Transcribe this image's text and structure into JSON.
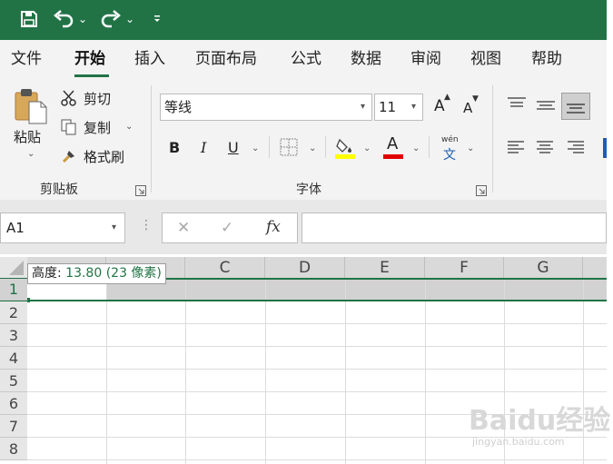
{
  "quick_access": {
    "save_icon": "save-icon",
    "undo_icon": "undo-icon",
    "redo_icon": "redo-icon",
    "customize_icon": "customize-icon",
    "dropdown": "⌄"
  },
  "menu": {
    "tabs": [
      "文件",
      "开始",
      "插入",
      "页面布局",
      "公式",
      "数据",
      "审阅",
      "视图",
      "帮助"
    ],
    "active": "开始"
  },
  "ribbon": {
    "clipboard": {
      "paste": "粘贴",
      "cut": "剪切",
      "copy": "复制",
      "format_painter": "格式刷",
      "group_label": "剪贴板"
    },
    "font": {
      "font_name": "等线",
      "font_size": "11",
      "grow": "A",
      "shrink": "A",
      "bold": "B",
      "italic": "I",
      "underline": "U",
      "font_color": "A",
      "phonetic_top": "wén",
      "phonetic_bottom": "文",
      "group_label": "字体"
    }
  },
  "formula_bar": {
    "name_box": "A1",
    "cancel": "✕",
    "enter": "✓",
    "fx": "fx",
    "formula": ""
  },
  "grid": {
    "columns": [
      "C",
      "D",
      "E",
      "F",
      "G"
    ],
    "rows": [
      "1",
      "2",
      "3",
      "4",
      "5",
      "6",
      "7",
      "8"
    ],
    "tooltip_label": "高度: ",
    "tooltip_value": "13.80 (23 像素)"
  },
  "watermark": {
    "text": "Baidu经验",
    "url": "jingyan.baidu.com"
  },
  "colors": {
    "accent": "#217346",
    "highlight_yellow": "#ffff00",
    "font_red": "#e00000"
  }
}
